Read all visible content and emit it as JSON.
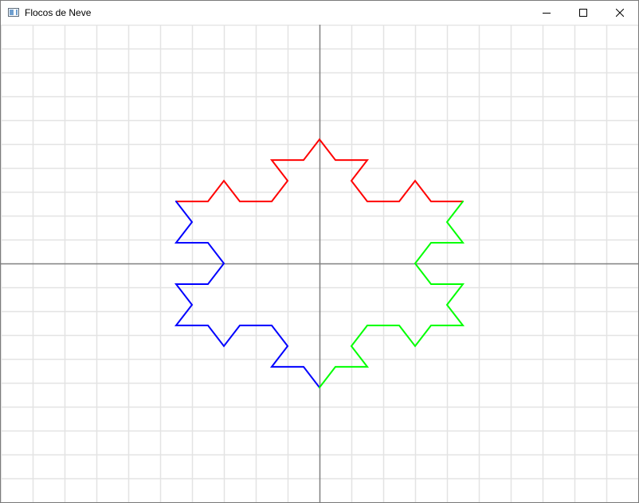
{
  "window": {
    "title": "Flocos de Neve",
    "controls": {
      "minimize_icon": "minimize-icon",
      "maximize_icon": "maximize-icon",
      "close_icon": "close-icon"
    }
  },
  "plot": {
    "background": "#ffffff",
    "grid_color": "#e3e3e3",
    "axis_color": "#808080",
    "grid": true,
    "grid_range": {
      "xmin": -10,
      "xmax": 10,
      "ymin": -10,
      "ymax": 10,
      "step": 1
    },
    "snowflake": {
      "levels": 2,
      "vertices": [
        [
          0.0,
          5.196
        ],
        [
          -1.5,
          4.33
        ],
        [
          -2.25,
          4.33
        ],
        [
          -3.0,
          2.598
        ],
        [
          -3.75,
          2.598
        ],
        [
          -4.5,
          2.598
        ],
        [
          -4.0,
          1.732
        ],
        [
          -4.5,
          0.866
        ],
        [
          -3.5,
          0.866
        ],
        [
          -3.0,
          0.0
        ],
        [
          -3.5,
          -0.866
        ],
        [
          -4.5,
          -0.866
        ],
        [
          -4.0,
          -1.732
        ],
        [
          -4.5,
          -2.598
        ],
        [
          -3.5,
          -2.598
        ],
        [
          -3.0,
          -3.464
        ],
        [
          -2.5,
          -2.598
        ],
        [
          -1.5,
          -2.598
        ],
        [
          -1.0,
          -3.464
        ],
        [
          -1.5,
          -4.33
        ],
        [
          -0.5,
          -4.33
        ],
        [
          0.0,
          -5.196
        ],
        [
          0.5,
          -4.33
        ],
        [
          1.5,
          -4.33
        ],
        [
          1.0,
          -3.464
        ],
        [
          1.5,
          -2.598
        ],
        [
          2.5,
          -2.598
        ],
        [
          3.0,
          -3.464
        ],
        [
          3.5,
          -2.598
        ],
        [
          4.5,
          -2.598
        ],
        [
          4.0,
          -1.732
        ],
        [
          4.5,
          -0.866
        ],
        [
          3.5,
          -0.866
        ],
        [
          3.0,
          0.0
        ],
        [
          3.5,
          0.866
        ],
        [
          4.5,
          0.866
        ],
        [
          4.0,
          1.732
        ],
        [
          4.5,
          2.598
        ],
        [
          3.5,
          2.598
        ],
        [
          3.0,
          2.598
        ],
        [
          2.25,
          4.33
        ],
        [
          1.5,
          4.33
        ],
        [
          1.0,
          5.196
        ],
        [
          0.0,
          5.196
        ]
      ],
      "sides": [
        {
          "color": "#ff0000",
          "points": [
            [
              -4.5,
              2.598
            ],
            [
              -4.0,
              2.598
            ],
            [
              -3.5,
              2.598
            ],
            [
              -3.0,
              3.464
            ],
            [
              -2.5,
              2.598
            ],
            [
              -1.5,
              2.598
            ],
            [
              -1.0,
              3.464
            ],
            [
              -1.5,
              4.33
            ],
            [
              -0.5,
              4.33
            ],
            [
              0.0,
              5.196
            ],
            [
              0.5,
              4.33
            ],
            [
              1.5,
              4.33
            ],
            [
              1.0,
              3.464
            ],
            [
              1.5,
              2.598
            ],
            [
              2.5,
              2.598
            ],
            [
              3.0,
              3.464
            ],
            [
              3.5,
              2.598
            ],
            [
              4.0,
              2.598
            ],
            [
              4.5,
              2.598
            ]
          ]
        },
        {
          "color": "#0000ff",
          "points": [
            [
              -4.5,
              2.598
            ],
            [
              -4.0,
              1.732
            ],
            [
              -4.5,
              0.866
            ],
            [
              -3.5,
              0.866
            ],
            [
              -3.0,
              0.0
            ],
            [
              -3.5,
              -0.866
            ],
            [
              -4.5,
              -0.866
            ],
            [
              -4.0,
              -1.732
            ],
            [
              -4.5,
              -2.598
            ],
            [
              -3.5,
              -2.598
            ],
            [
              -3.0,
              -3.464
            ],
            [
              -2.5,
              -2.598
            ],
            [
              -1.5,
              -2.598
            ],
            [
              -1.0,
              -3.464
            ],
            [
              -1.5,
              -4.33
            ],
            [
              -0.5,
              -4.33
            ],
            [
              0.0,
              -5.196
            ]
          ]
        },
        {
          "color": "#00ff00",
          "points": [
            [
              0.0,
              -5.196
            ],
            [
              0.5,
              -4.33
            ],
            [
              1.5,
              -4.33
            ],
            [
              1.0,
              -3.464
            ],
            [
              1.5,
              -2.598
            ],
            [
              2.5,
              -2.598
            ],
            [
              3.0,
              -3.464
            ],
            [
              3.5,
              -2.598
            ],
            [
              4.5,
              -2.598
            ],
            [
              4.0,
              -1.732
            ],
            [
              4.5,
              -0.866
            ],
            [
              3.5,
              -0.866
            ],
            [
              3.0,
              0.0
            ],
            [
              3.5,
              0.866
            ],
            [
              4.5,
              0.866
            ],
            [
              4.0,
              1.732
            ],
            [
              4.5,
              2.598
            ]
          ]
        }
      ]
    }
  }
}
